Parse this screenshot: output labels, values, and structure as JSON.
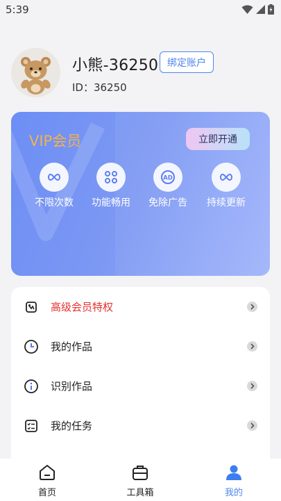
{
  "status_bar": {
    "time": "5:39"
  },
  "profile": {
    "username": "小熊-36250",
    "bind_button": "绑定账户",
    "id_text": "ID：36250"
  },
  "vip": {
    "title": "VIP会员",
    "open_button": "立即开通",
    "perks": [
      {
        "label": "不限次数",
        "icon": "infinity-icon"
      },
      {
        "label": "功能畅用",
        "icon": "command-icon"
      },
      {
        "label": "免除广告",
        "icon": "no-ads-icon"
      },
      {
        "label": "持续更新",
        "icon": "infinity-icon"
      }
    ]
  },
  "menu": {
    "items": [
      {
        "label": "高级会员特权",
        "icon": "vip-privilege-icon",
        "highlight": true
      },
      {
        "label": "我的作品",
        "icon": "clock-icon"
      },
      {
        "label": "识别作品",
        "icon": "info-icon"
      },
      {
        "label": "我的任务",
        "icon": "task-list-icon"
      }
    ]
  },
  "tabs": [
    {
      "label": "首页",
      "icon": "home-icon"
    },
    {
      "label": "工具箱",
      "icon": "toolbox-icon"
    },
    {
      "label": "我的",
      "icon": "profile-icon",
      "active": true
    }
  ],
  "colors": {
    "accent": "#4f86ec",
    "vip_gold": "#f3b24b",
    "highlight_red": "#e5322d"
  }
}
